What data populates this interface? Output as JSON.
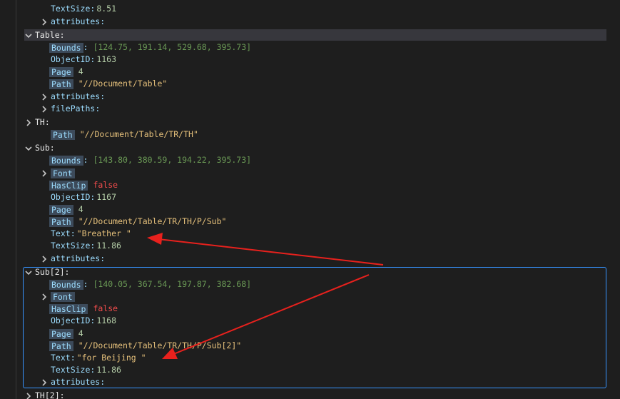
{
  "tree": {
    "top_textsize": {
      "key": "TextSize",
      "value": "8.51"
    },
    "top_attributes": {
      "key": "attributes"
    },
    "table": {
      "key": "Table",
      "bounds": {
        "key": "Bounds",
        "value": "[124.75, 191.14, 529.68, 395.73]"
      },
      "objectid": {
        "key": "ObjectID",
        "value": "1163"
      },
      "page": {
        "key": "Page",
        "value": "4"
      },
      "path": {
        "key": "Path",
        "value": "\"//Document/Table\""
      },
      "attributes": {
        "key": "attributes"
      },
      "filepaths": {
        "key": "filePaths"
      }
    },
    "th": {
      "key": "TH",
      "path": {
        "key": "Path",
        "value": "\"//Document/Table/TR/TH\""
      }
    },
    "sub": {
      "key": "Sub",
      "bounds": {
        "key": "Bounds",
        "value": "[143.80, 380.59, 194.22, 395.73]"
      },
      "font": {
        "key": "Font"
      },
      "hasclip": {
        "key": "HasClip",
        "value": "false"
      },
      "objectid": {
        "key": "ObjectID",
        "value": "1167"
      },
      "page": {
        "key": "Page",
        "value": "4"
      },
      "path": {
        "key": "Path",
        "value": "\"//Document/Table/TR/TH/P/Sub\""
      },
      "text": {
        "key": "Text",
        "value": "\"Breather \""
      },
      "textsize": {
        "key": "TextSize",
        "value": "11.86"
      },
      "attributes": {
        "key": "attributes"
      }
    },
    "sub2": {
      "key": "Sub[2]",
      "bounds": {
        "key": "Bounds",
        "value": "[140.05, 367.54, 197.87, 382.68]"
      },
      "font": {
        "key": "Font"
      },
      "hasclip": {
        "key": "HasClip",
        "value": "false"
      },
      "objectid": {
        "key": "ObjectID",
        "value": "1168"
      },
      "page": {
        "key": "Page",
        "value": "4"
      },
      "path": {
        "key": "Path",
        "value": "\"//Document/Table/TR/TH/P/Sub[2]\""
      },
      "text": {
        "key": "Text",
        "value": "\"for Beijing \""
      },
      "textsize": {
        "key": "TextSize",
        "value": "11.86"
      },
      "attributes": {
        "key": "attributes"
      }
    },
    "th2": {
      "key": "TH[2]"
    }
  },
  "colors": {
    "background": "#1e1e1e",
    "key": "#9cdcfe",
    "key_box": "#3c4a5a",
    "string": "#e5c07b",
    "number": "#b5cea8",
    "boolean": "#f14c4c",
    "focus_border": "#3794ff",
    "annotation_arrow": "#e8211d"
  },
  "icons": {
    "expanded": "chevron-down-icon",
    "collapsed": "chevron-right-icon"
  }
}
